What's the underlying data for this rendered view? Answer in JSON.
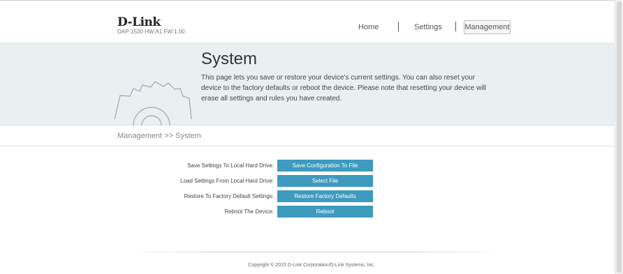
{
  "header": {
    "logo": "D-Link",
    "model_info": "DAP-1530   HW:A1   FW:1.00",
    "nav": {
      "home": "Home",
      "settings": "Settings",
      "management": "Management"
    }
  },
  "hero": {
    "title": "System",
    "description": "This page lets you save or restore your device's current settings. You can also reset your device to the factory defaults or reboot the device. Please note that resetting your device will erase all settings and rules you have created."
  },
  "breadcrumb": "Management >> System",
  "actions": [
    {
      "label": "Save Settings To Local Hard Drive:",
      "button": "Save Configuration To File"
    },
    {
      "label": "Load Settings From Local Hard Drive:",
      "button": "Select File"
    },
    {
      "label": "Restore To Factory Default Settings:",
      "button": "Restore Factory Defaults"
    },
    {
      "label": "Reboot The Device:",
      "button": "Reboot"
    }
  ],
  "footer": "Copyright © 2015 D-Link Corporation/D-Link Systems, Inc.",
  "colors": {
    "button": "#3e9bbf",
    "hero_bg": "#eaf0f2"
  },
  "icons": {
    "hero_graphic": "gear-icon"
  }
}
